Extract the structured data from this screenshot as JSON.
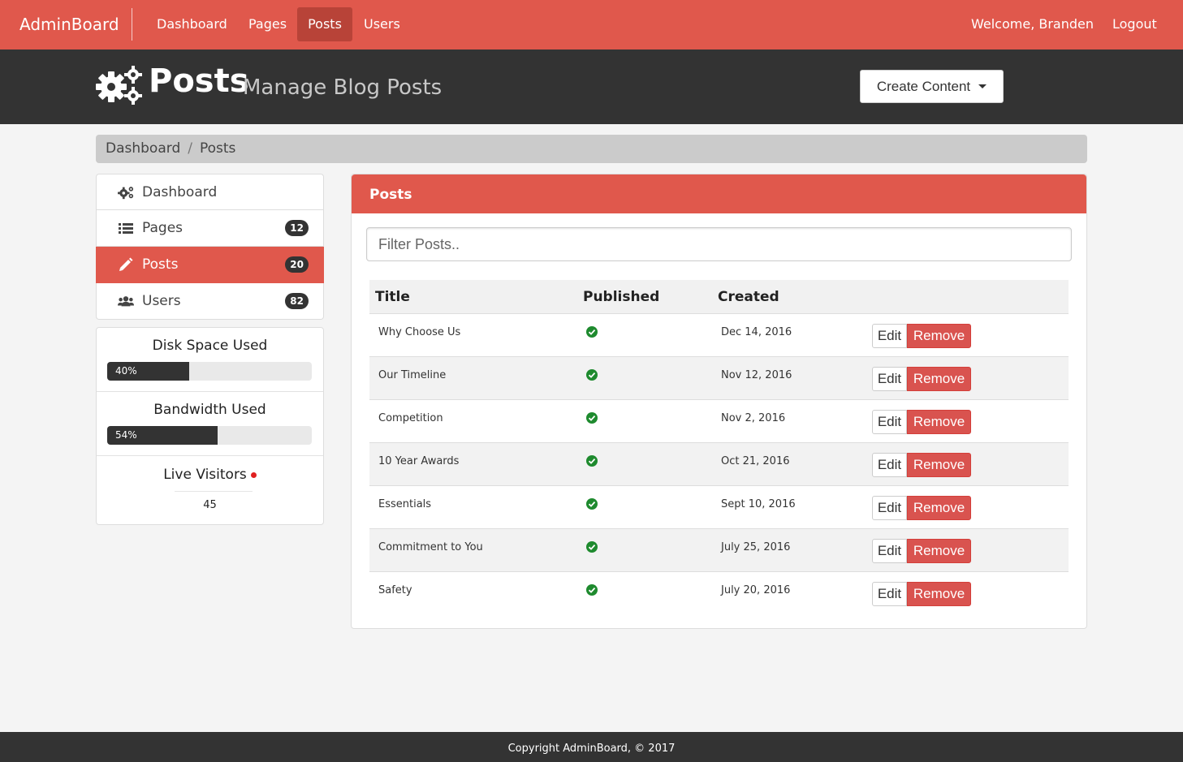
{
  "navbar": {
    "brand": "AdminBoard",
    "links": [
      {
        "label": "Dashboard",
        "active": false
      },
      {
        "label": "Pages",
        "active": false
      },
      {
        "label": "Posts",
        "active": true
      },
      {
        "label": "Users",
        "active": false
      }
    ],
    "welcome": "Welcome, Branden",
    "logout": "Logout"
  },
  "header": {
    "icon": "cogs-icon",
    "title": "Posts",
    "subtitle": "Manage Blog Posts",
    "create_button": "Create Content"
  },
  "breadcrumb": {
    "items": [
      "Dashboard",
      "Posts"
    ],
    "separator": "/"
  },
  "sidebar": {
    "items": [
      {
        "label": "Dashboard",
        "icon": "cogs-icon",
        "badge": null,
        "active": false
      },
      {
        "label": "Pages",
        "icon": "list-icon",
        "badge": "12",
        "active": false
      },
      {
        "label": "Posts",
        "icon": "pencil-icon",
        "badge": "20",
        "active": true
      },
      {
        "label": "Users",
        "icon": "users-icon",
        "badge": "82",
        "active": false
      }
    ]
  },
  "stats": {
    "disk": {
      "title": "Disk Space Used",
      "percent": 40,
      "label": "40%"
    },
    "bandwidth": {
      "title": "Bandwidth Used",
      "percent": 54,
      "label": "54%"
    },
    "live": {
      "title": "Live Visitors",
      "count": "45"
    }
  },
  "posts_panel": {
    "title": "Posts",
    "filter_placeholder": "Filter Posts..",
    "columns": [
      "Title",
      "Published",
      "Created"
    ],
    "edit_label": "Edit",
    "remove_label": "Remove",
    "rows": [
      {
        "title": "Why Choose Us",
        "published": true,
        "created": "Dec 14, 2016"
      },
      {
        "title": "Our Timeline",
        "published": true,
        "created": "Nov 12, 2016"
      },
      {
        "title": "Competition",
        "published": true,
        "created": "Nov 2, 2016"
      },
      {
        "title": "10 Year Awards",
        "published": true,
        "created": "Oct 21, 2016"
      },
      {
        "title": "Essentials",
        "published": true,
        "created": "Sept 10, 2016"
      },
      {
        "title": "Commitment to You",
        "published": true,
        "created": "July 25, 2016"
      },
      {
        "title": "Safety",
        "published": true,
        "created": "July 20, 2016"
      }
    ]
  },
  "footer": {
    "text": "Copyright AdminBoard, © 2017"
  },
  "colors": {
    "brand": "#e0584c",
    "brand_dark": "#b84338",
    "header_bg": "#333333",
    "remove": "#d9534f",
    "published": "#1e8a2e",
    "live_dot": "#e02020"
  }
}
